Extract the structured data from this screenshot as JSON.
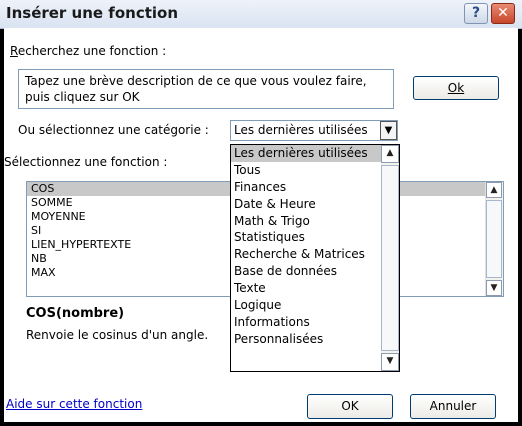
{
  "window": {
    "title": "Insérer une fonction",
    "help_icon": "?",
    "close_icon": "✕"
  },
  "search": {
    "label": "Recherchez une fonction :",
    "description": "Tapez une brève description de ce que vous voulez faire, puis cliquez sur OK",
    "go_button": "Ok"
  },
  "category": {
    "label": "Ou sélectionnez une catégorie :",
    "selected": "Les dernières utilisées",
    "options": [
      "Les dernières utilisées",
      "Tous",
      "Finances",
      "Date & Heure",
      "Math & Trigo",
      "Statistiques",
      "Recherche & Matrices",
      "Base de données",
      "Texte",
      "Logique",
      "Informations",
      "Personnalisées"
    ]
  },
  "functions": {
    "label": "Sélectionnez une fonction :",
    "items": [
      "COS",
      "SOMME",
      "MOYENNE",
      "SI",
      "LIEN_HYPERTEXTE",
      "NB",
      "MAX"
    ],
    "selected": "COS"
  },
  "details": {
    "signature": "COS(nombre)",
    "description": "Renvoie le cosinus d'un angle."
  },
  "footer": {
    "help_link": "Aide sur cette fonction",
    "ok_button": "OK",
    "cancel_button": "Annuler"
  }
}
